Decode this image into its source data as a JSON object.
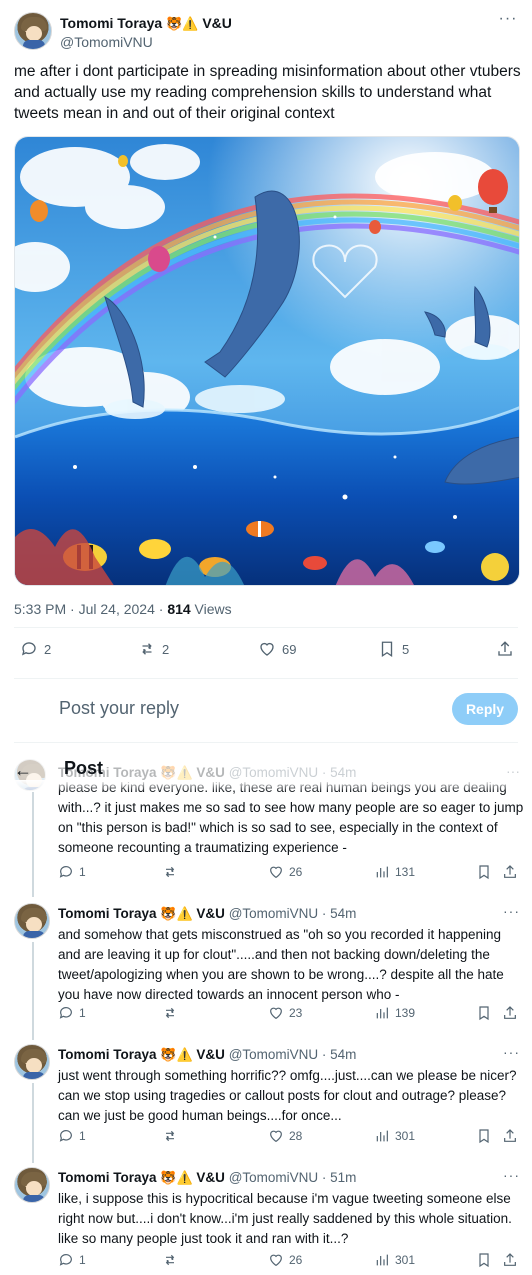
{
  "tweet": {
    "author_name": "Tomomi Toraya",
    "author_emoji": "🐯⚠️",
    "author_tag": "V&U",
    "handle": "@TomomiVNU",
    "text": "me after i dont participate in spreading misinformation about other vtubers and actually use my reading comprehension skills to understand what tweets mean in and out of their original context",
    "timestamp": "5:33 PM · Jul 24, 2024 · ",
    "views_count": "814",
    "views_label": " Views",
    "stats": {
      "replies": "2",
      "reposts": "2",
      "likes": "69",
      "bookmarks": "5"
    }
  },
  "reply_box": {
    "placeholder": "Post your reply",
    "button": "Reply"
  },
  "header": {
    "title": "Post",
    "back": "←"
  },
  "replies": [
    {
      "name": "Tomomi Toraya",
      "emoji": "🐯⚠️",
      "tag": "V&U",
      "handle": "@TomomiVNU · 54m",
      "text": "please be kind everyone. like, these are real human beings you are dealing with...? it just makes me so sad to see how many people are so eager to jump on \"this person is bad!\" which is so sad to see, especially in the context of someone recounting a traumatizing experience -",
      "replies": "1",
      "likes": "26",
      "views": "131"
    },
    {
      "name": "Tomomi Toraya",
      "emoji": "🐯⚠️",
      "tag": "V&U",
      "handle": "@TomomiVNU · 54m",
      "text": "and somehow that gets misconstrued as \"oh so you recorded it happening and are leaving it up for clout\".....and then not backing down/deleting the tweet/apologizing when you are shown to be wrong....? despite all the hate you have now directed towards an innocent person who -",
      "replies": "1",
      "likes": "23",
      "views": "139"
    },
    {
      "name": "Tomomi Toraya",
      "emoji": "🐯⚠️",
      "tag": "V&U",
      "handle": "@TomomiVNU · 54m",
      "text": "just went through something horrific?? omfg....just....can we please be nicer? can we stop using tragedies or callout posts for clout and outrage? please? can we just be good human beings....for once...",
      "replies": "1",
      "likes": "28",
      "views": "301"
    },
    {
      "name": "Tomomi Toraya",
      "emoji": "🐯⚠️",
      "tag": "V&U",
      "handle": "@TomomiVNU · 51m",
      "text": "like, i suppose this is hypocritical because i'm vague tweeting someone else right now but....i don't know...i'm just really saddened by this whole situation. like so many people just took it and ran with it...?",
      "replies": "1",
      "likes": "26",
      "views": "301"
    }
  ],
  "icons": {
    "reply": "speech-bubble-icon",
    "repost": "repost-icon",
    "like": "heart-icon",
    "bookmark": "bookmark-icon",
    "share": "share-icon",
    "views": "bar-chart-icon",
    "more": "ellipsis-icon"
  },
  "colors": {
    "accent": "#1d9bf0",
    "reply_button": "#8ecdf8",
    "text": "#0f1419",
    "muted": "#536471"
  }
}
